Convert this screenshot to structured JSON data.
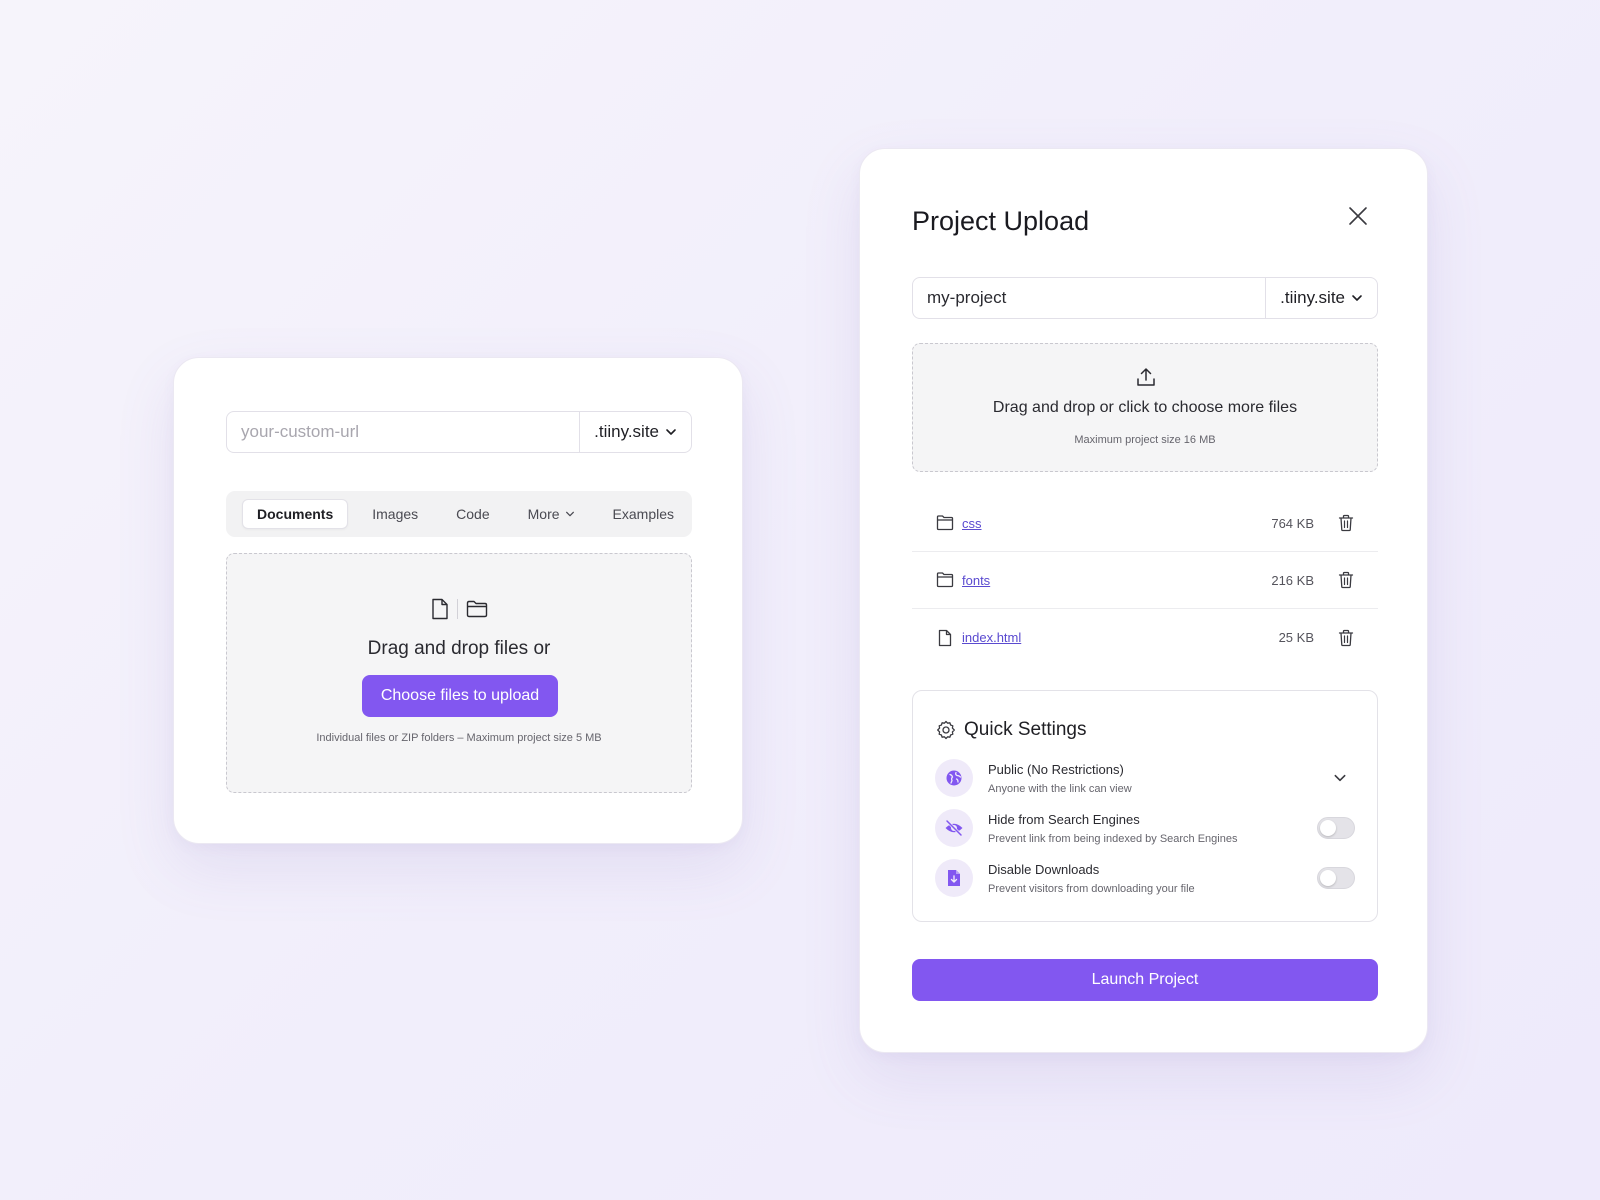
{
  "left_card": {
    "url_placeholder": "your-custom-url",
    "domain": ".tiiny.site",
    "tabs": [
      {
        "label": "Documents",
        "active": true
      },
      {
        "label": "Images"
      },
      {
        "label": "Code"
      },
      {
        "label": "More",
        "dropdown": true
      },
      {
        "label": "Examples"
      }
    ],
    "drop_title": "Drag and drop files or",
    "choose_button": "Choose files to upload",
    "drop_note": "Individual files or ZIP folders – Maximum project size 5 MB"
  },
  "right_card": {
    "title": "Project Upload",
    "url_value": "my-project",
    "domain": ".tiiny.site",
    "drop_title": "Drag and drop or click to choose more files",
    "drop_note": "Maximum project size 16 MB",
    "files": [
      {
        "name": "css",
        "size": "764 KB",
        "icon": "folder-icon"
      },
      {
        "name": "fonts",
        "size": "216 KB",
        "icon": "folder-icon"
      },
      {
        "name": "index.html",
        "size": "25 KB",
        "icon": "file-icon"
      }
    ],
    "quick_settings": {
      "title": "Quick Settings",
      "items": [
        {
          "label": "Public (No Restrictions)",
          "sub": "Anyone with the link can view",
          "icon": "globe-icon",
          "control": "dropdown"
        },
        {
          "label": "Hide from Search Engines",
          "sub": "Prevent link from being indexed by Search Engines",
          "icon": "eye-off-icon",
          "control": "toggle",
          "on": false
        },
        {
          "label": "Disable Downloads",
          "sub": "Prevent visitors from downloading your file",
          "icon": "file-download-icon",
          "control": "toggle",
          "on": false
        }
      ]
    },
    "launch_button": "Launch Project"
  },
  "colors": {
    "accent": "#8257f0",
    "link": "#5a4ad0",
    "icon_bg": "#efeaf9"
  }
}
